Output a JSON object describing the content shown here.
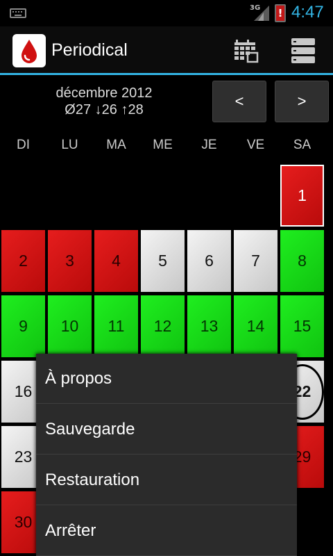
{
  "status_bar": {
    "network": "3G",
    "battery_alert": "!",
    "time": "4:47",
    "icons": [
      "keyboard-icon",
      "signal-icon",
      "battery-alert-icon"
    ]
  },
  "action_bar": {
    "title": "Periodical",
    "icons": [
      "blood-drop-icon",
      "calendar-icon",
      "overflow-menu-icon"
    ]
  },
  "month": {
    "title": "décembre 2012",
    "stats": "Ø27 ↓26 ↑28",
    "prev_label": "<",
    "next_label": ">"
  },
  "weekdays": [
    "DI",
    "LU",
    "MA",
    "ME",
    "JE",
    "VE",
    "SA"
  ],
  "days": [
    {
      "label": "1",
      "type": "red",
      "selected": true
    },
    {
      "label": "2",
      "type": "red"
    },
    {
      "label": "3",
      "type": "red"
    },
    {
      "label": "4",
      "type": "red"
    },
    {
      "label": "5",
      "type": "white"
    },
    {
      "label": "6",
      "type": "white"
    },
    {
      "label": "7",
      "type": "white"
    },
    {
      "label": "8",
      "type": "green"
    },
    {
      "label": "9",
      "type": "green"
    },
    {
      "label": "10",
      "type": "green"
    },
    {
      "label": "11",
      "type": "green"
    },
    {
      "label": "12",
      "type": "green"
    },
    {
      "label": "13",
      "type": "green"
    },
    {
      "label": "14",
      "type": "green"
    },
    {
      "label": "15",
      "type": "green"
    },
    {
      "label": "16",
      "type": "white"
    },
    {
      "label": "22",
      "type": "white",
      "circled": true
    },
    {
      "label": "23",
      "type": "white"
    },
    {
      "label": "29",
      "type": "red"
    },
    {
      "label": "30",
      "type": "red"
    }
  ],
  "menu": {
    "items": [
      "À propos",
      "Sauvegarde",
      "Restauration",
      "Arrêter"
    ]
  },
  "colors": {
    "accent": "#33b5e5",
    "period_red": "#d81515",
    "fertile_green": "#15dd15",
    "neutral_white": "#e0e0e0"
  }
}
